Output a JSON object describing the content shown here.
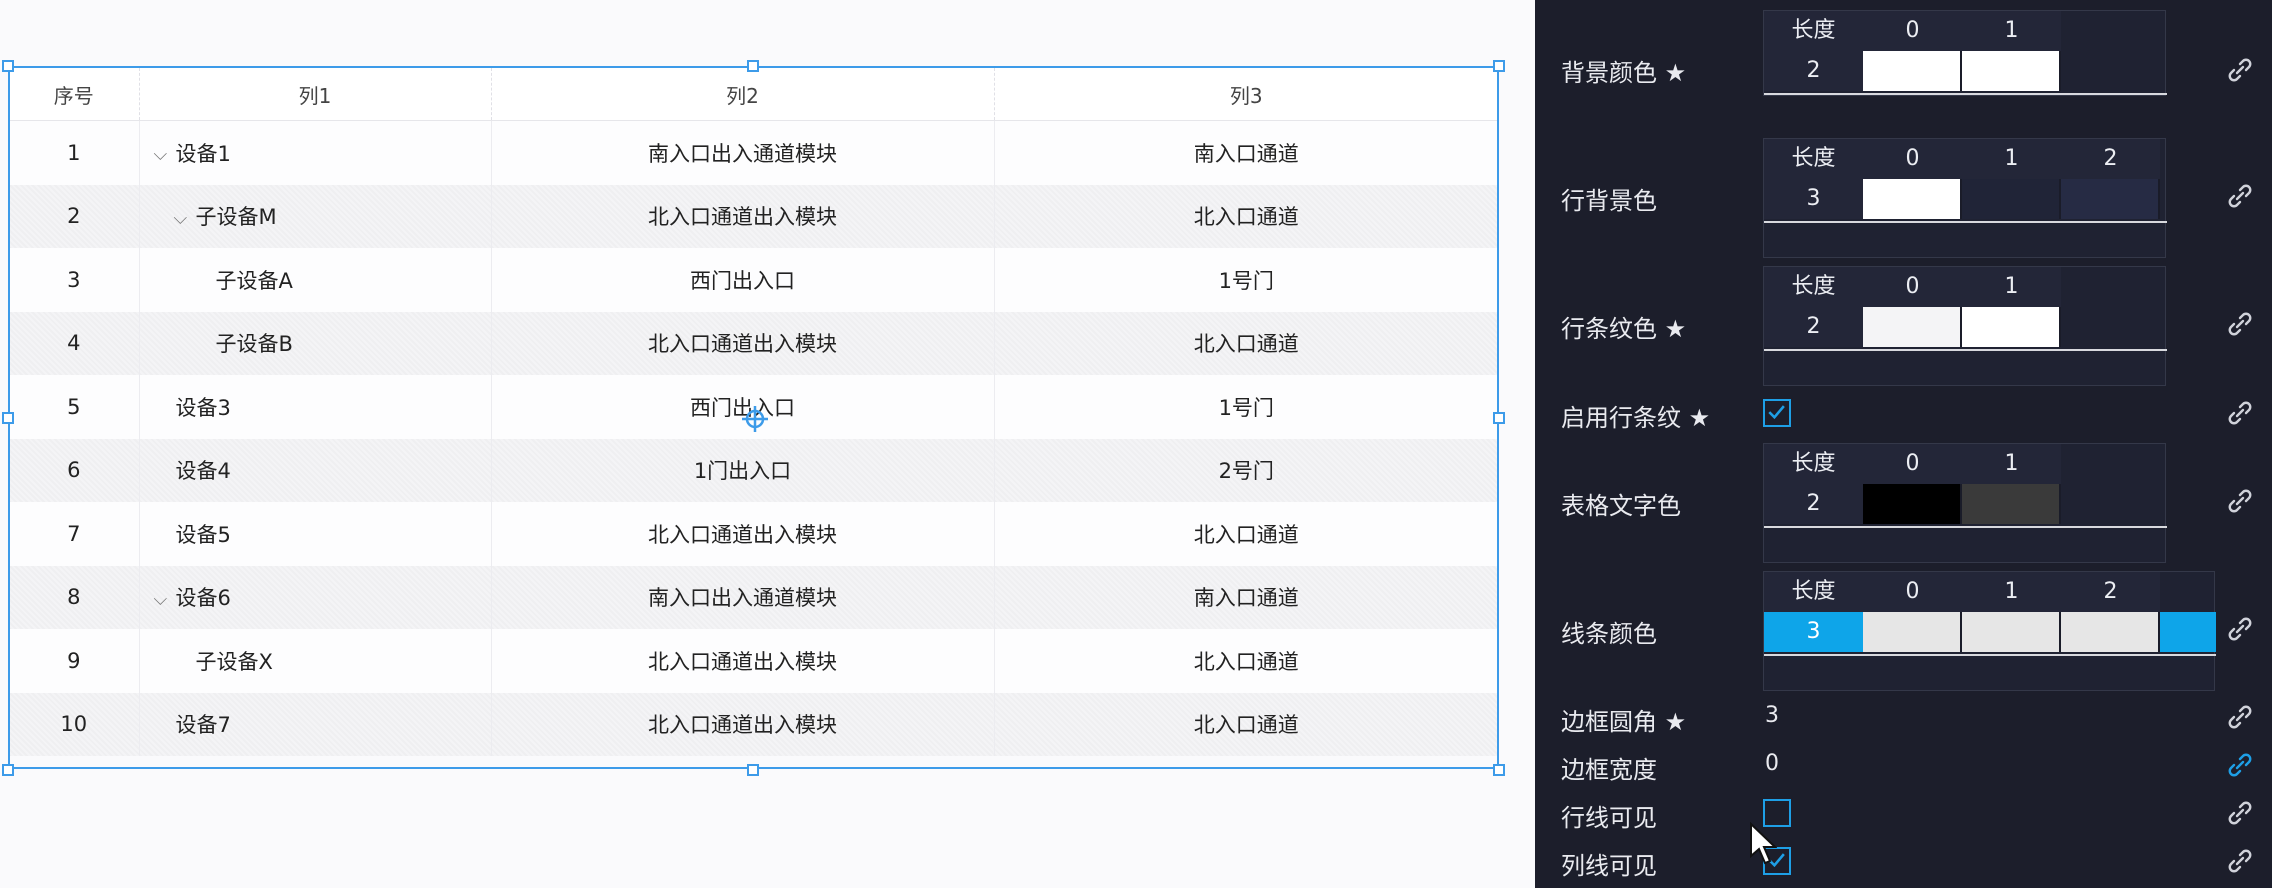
{
  "table": {
    "columns": [
      "序号",
      "列1",
      "列2",
      "列3"
    ],
    "rows": [
      {
        "index": "1",
        "col1": "设备1",
        "col2": "南入口出入通道模块",
        "col3": "南入口通道",
        "level": 0,
        "expandable": true
      },
      {
        "index": "2",
        "col1": "子设备M",
        "col2": "北入口通道出入模块",
        "col3": "北入口通道",
        "level": 1,
        "expandable": true
      },
      {
        "index": "3",
        "col1": "子设备A",
        "col2": "西门出入口",
        "col3": "1号门",
        "level": 2,
        "expandable": false
      },
      {
        "index": "4",
        "col1": "子设备B",
        "col2": "北入口通道出入模块",
        "col3": "北入口通道",
        "level": 2,
        "expandable": false
      },
      {
        "index": "5",
        "col1": "设备3",
        "col2": "西门出入口",
        "col3": "1号门",
        "level": 0,
        "expandable": false
      },
      {
        "index": "6",
        "col1": "设备4",
        "col2": "1门出入口",
        "col3": "2号门",
        "level": 0,
        "expandable": false
      },
      {
        "index": "7",
        "col1": "设备5",
        "col2": "北入口通道出入模块",
        "col3": "北入口通道",
        "level": 0,
        "expandable": false
      },
      {
        "index": "8",
        "col1": "设备6",
        "col2": "南入口出入通道模块",
        "col3": "南入口通道",
        "level": 0,
        "expandable": true
      },
      {
        "index": "9",
        "col1": "子设备X",
        "col2": "北入口通道出入模块",
        "col3": "北入口通道",
        "level": 1,
        "expandable": false
      },
      {
        "index": "10",
        "col1": "设备7",
        "col2": "北入口通道出入模块",
        "col3": "北入口通道",
        "level": 0,
        "expandable": false
      }
    ]
  },
  "panel": {
    "bg_color": {
      "label": "背景颜色 ★",
      "len_label": "长度",
      "len": "2",
      "indices": [
        "0",
        "1"
      ],
      "colors": [
        "#ffffff",
        "#ffffff"
      ]
    },
    "row_bg": {
      "label": "行背景色",
      "len_label": "长度",
      "len": "3",
      "indices": [
        "0",
        "1",
        "2"
      ],
      "colors": [
        "#ffffff",
        "#202437",
        "#262b44"
      ]
    },
    "stripe": {
      "label": "行条纹色 ★",
      "len_label": "长度",
      "len": "2",
      "indices": [
        "0",
        "1"
      ],
      "colors": [
        "#f4f4f6",
        "#ffffff"
      ]
    },
    "enable_stripe": {
      "label": "启用行条纹 ★",
      "checked": true
    },
    "text_color": {
      "label": "表格文字色",
      "len_label": "长度",
      "len": "2",
      "indices": [
        "0",
        "1"
      ],
      "colors": [
        "#000000",
        "#3a3a3a"
      ]
    },
    "line_color": {
      "label": "线条颜色",
      "len_label": "长度",
      "len": "3",
      "indices": [
        "0",
        "1",
        "2"
      ],
      "colors": [
        "#e6e6e6",
        "#e6e6e6",
        "#e6e6e6"
      ],
      "len_bg": "#0ea5e9"
    },
    "radius": {
      "label": "边框圆角 ★",
      "value": "3"
    },
    "border_width": {
      "label": "边框宽度",
      "value": "0"
    },
    "row_line": {
      "label": "行线可见",
      "checked": false
    },
    "col_line": {
      "label": "列线可见",
      "checked": true
    }
  },
  "colors": {
    "accent": "#3d9be9",
    "check": "#1e9fe6",
    "link_active": "#1e9fe6",
    "link": "#d0d2da"
  }
}
